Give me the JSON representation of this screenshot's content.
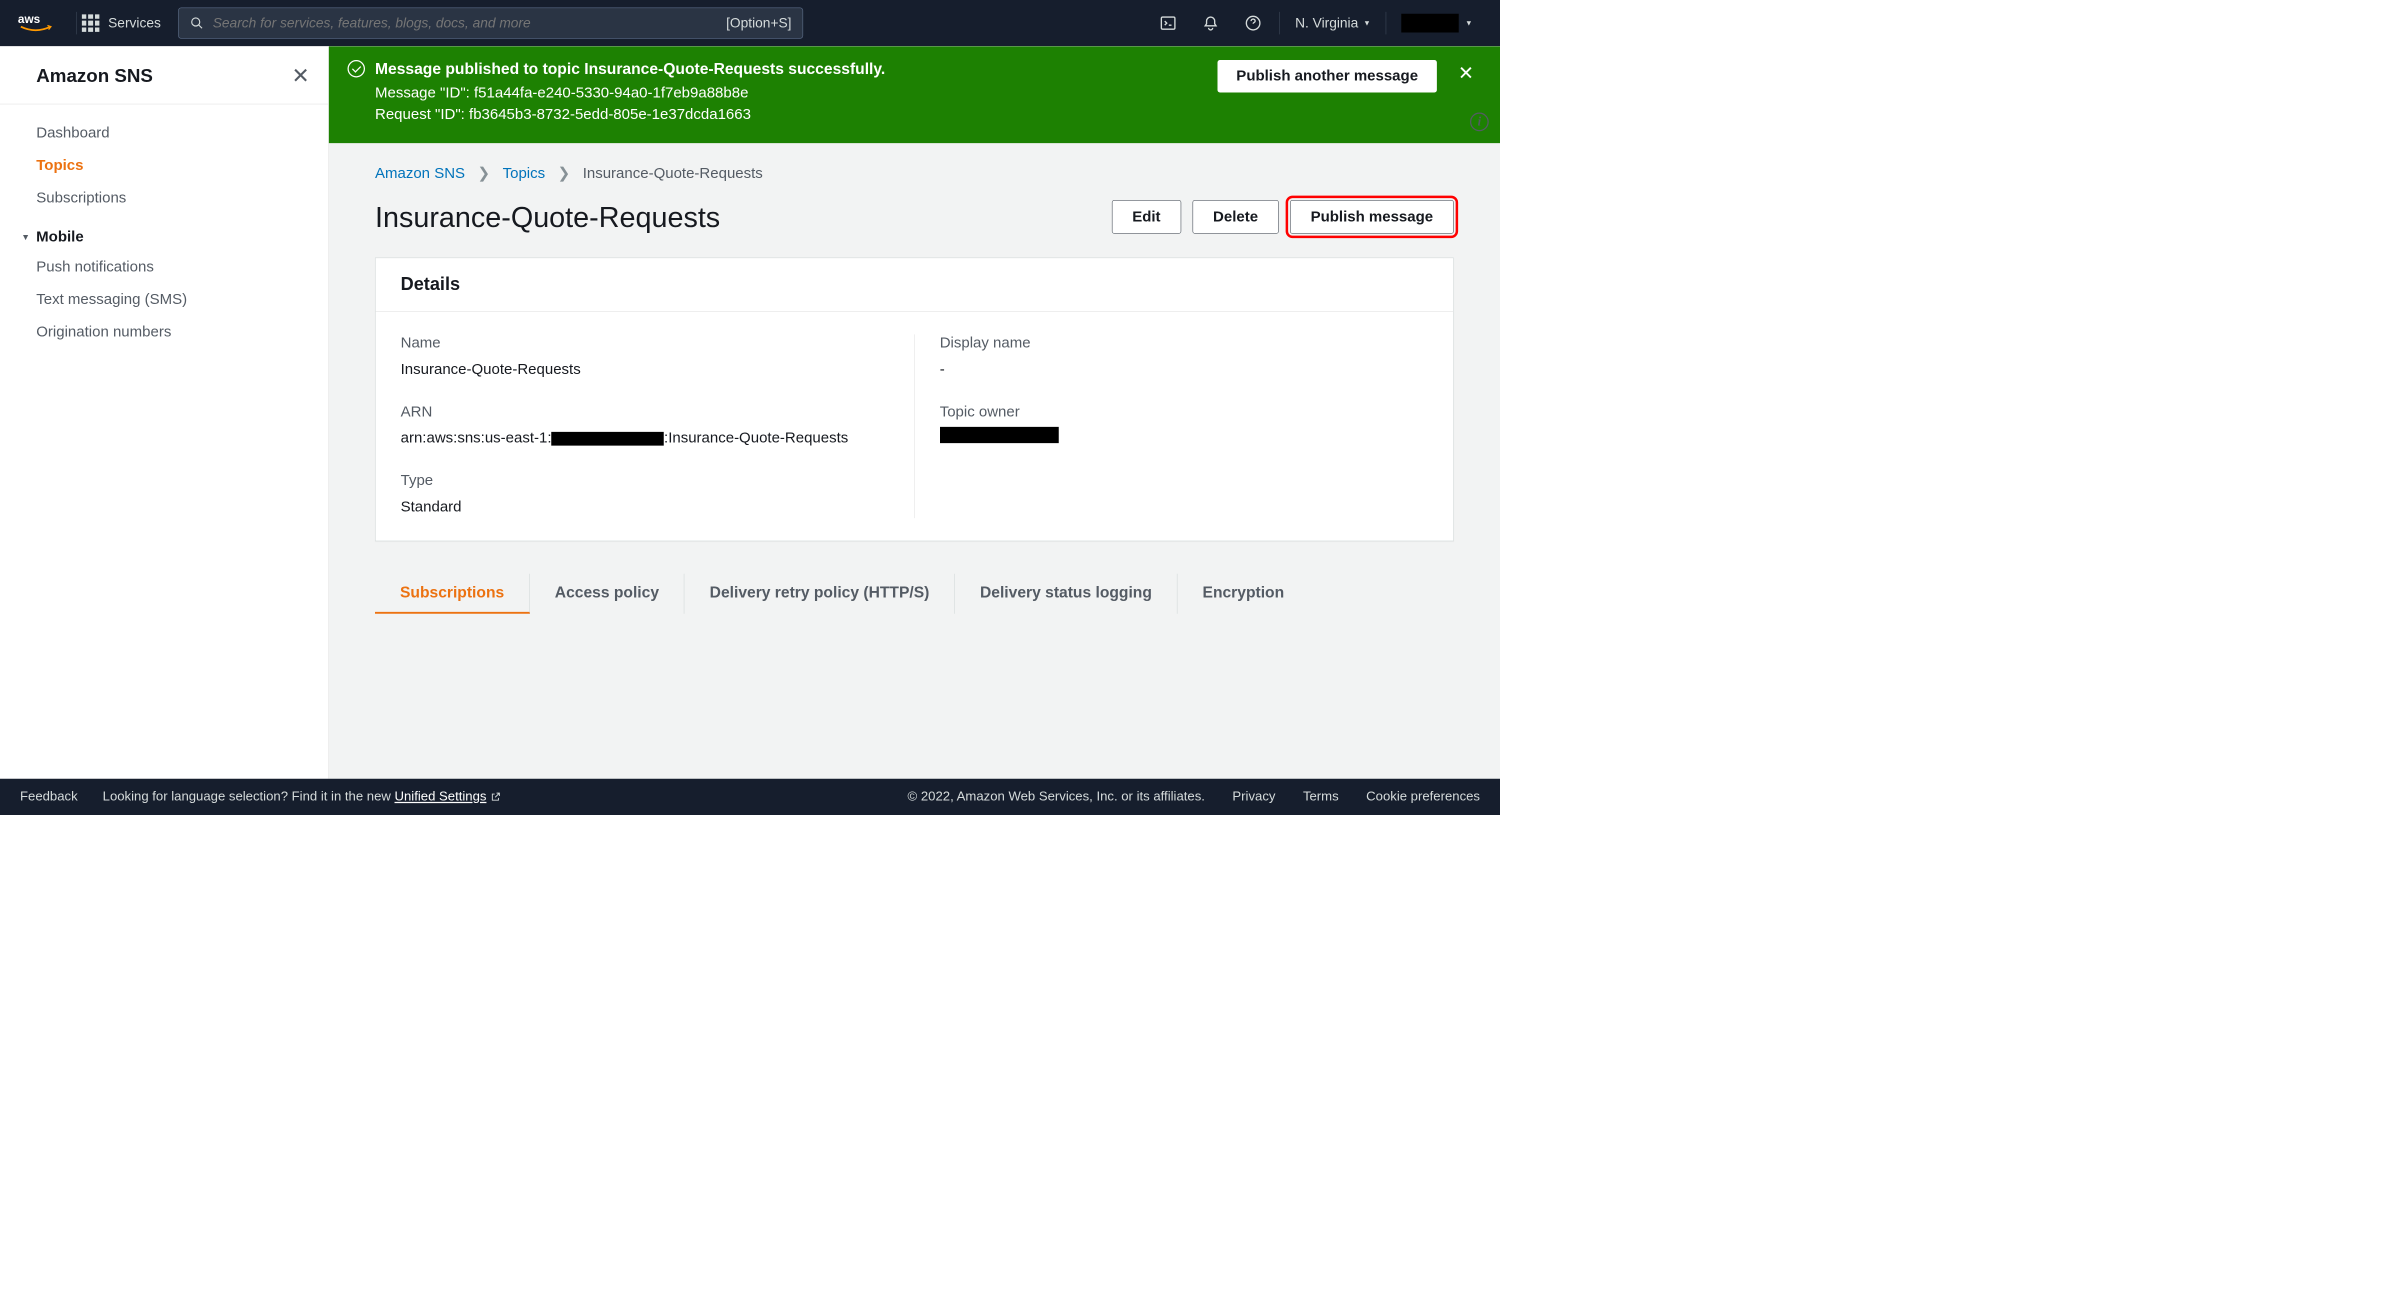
{
  "topnav": {
    "services": "Services",
    "search_placeholder": "Search for services, features, blogs, docs, and more",
    "search_shortcut": "[Option+S]",
    "region": "N. Virginia"
  },
  "sidebar": {
    "title": "Amazon SNS",
    "items": {
      "dashboard": "Dashboard",
      "topics": "Topics",
      "subscriptions": "Subscriptions"
    },
    "mobile_section": "Mobile",
    "mobile_items": {
      "push": "Push notifications",
      "sms": "Text messaging (SMS)",
      "origination": "Origination numbers"
    }
  },
  "banner": {
    "title": "Message published to topic Insurance-Quote-Requests successfully.",
    "message_id": "Message \"ID\": f51a44fa-e240-5330-94a0-1f7eb9a88b8e",
    "request_id": "Request \"ID\": fb3645b3-8732-5edd-805e-1e37dcda1663",
    "button": "Publish another message"
  },
  "breadcrumb": {
    "root": "Amazon SNS",
    "topics": "Topics",
    "current": "Insurance-Quote-Requests"
  },
  "page": {
    "title": "Insurance-Quote-Requests",
    "edit": "Edit",
    "delete": "Delete",
    "publish": "Publish message"
  },
  "details": {
    "panel_title": "Details",
    "name_label": "Name",
    "name_value": "Insurance-Quote-Requests",
    "display_label": "Display name",
    "display_value": "-",
    "arn_label": "ARN",
    "arn_prefix": "arn:aws:sns:us-east-1:",
    "arn_suffix": ":Insurance-Quote-Requests",
    "owner_label": "Topic owner",
    "type_label": "Type",
    "type_value": "Standard"
  },
  "tabs": {
    "subscriptions": "Subscriptions",
    "access": "Access policy",
    "retry": "Delivery retry policy (HTTP/S)",
    "status": "Delivery status logging",
    "encryption": "Encryption"
  },
  "footer": {
    "feedback": "Feedback",
    "language_prompt": "Looking for language selection? Find it in the new ",
    "unified": "Unified Settings",
    "copyright": "© 2022, Amazon Web Services, Inc. or its affiliates.",
    "privacy": "Privacy",
    "terms": "Terms",
    "cookie": "Cookie preferences"
  }
}
